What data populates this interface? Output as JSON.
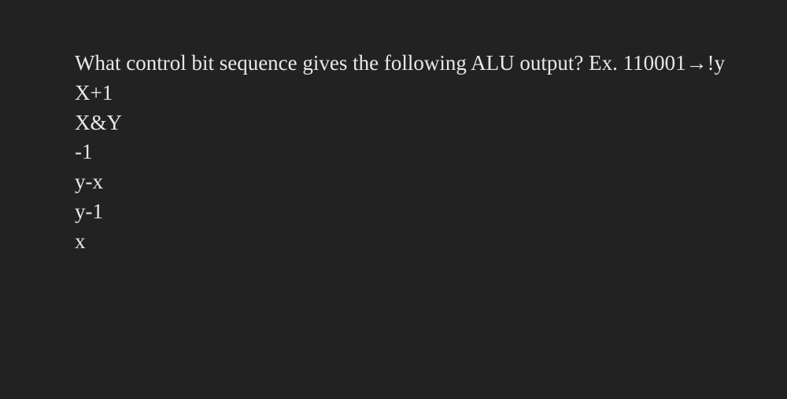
{
  "question": {
    "prompt": "What control bit sequence gives the following ALU output? Ex. 110001→!y",
    "items": [
      "X+1",
      "X&Y",
      "-1",
      "y-x",
      "y-1",
      "x"
    ]
  }
}
